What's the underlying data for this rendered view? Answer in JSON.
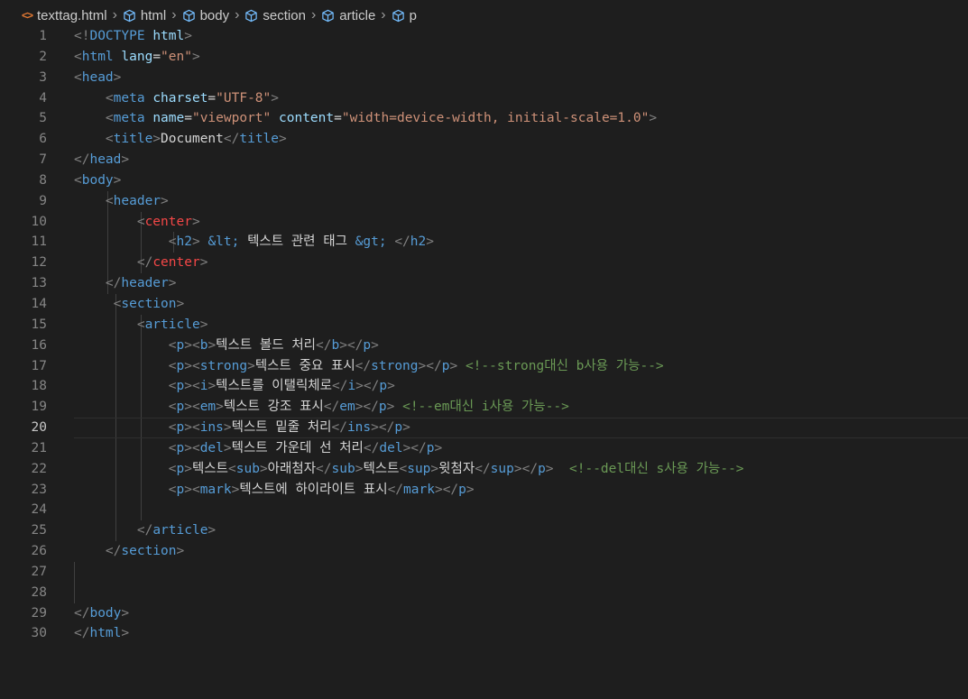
{
  "breadcrumb": {
    "file": "texttag.html",
    "items": [
      "html",
      "body",
      "section",
      "article",
      "p"
    ]
  },
  "editor": {
    "current_line": 20,
    "lines": [
      "<!DOCTYPE html>",
      "<html lang=\"en\">",
      "<head>",
      "    <meta charset=\"UTF-8\">",
      "    <meta name=\"viewport\" content=\"width=device-width, initial-scale=1.0\">",
      "    <title>Document</title>",
      "</head>",
      "<body>",
      "    <header>",
      "        <center>",
      "            <h2> &lt; 텍스트 관련 태그 &gt; </h2>",
      "        </center>",
      "    </header>",
      "     <section>",
      "        <article>",
      "            <p><b>텍스트 볼드 처리</b></p>",
      "            <p><strong>텍스트 중요 표시</strong></p> <!--strong대신 b사용 가능-->",
      "            <p><i>텍스트를 이탤릭체로</i></p>",
      "            <p><em>텍스트 강조 표시</em></p> <!--em대신 i사용 가능-->",
      "            <p><ins>텍스트 밑줄 처리</ins></p>",
      "            <p><del>텍스트 가운데 선 처리</del></p>",
      "            <p>텍스트<sub>아래첨자</sub>텍스트<sup>윗첨자</sup></p>  <!--del대신 s사용 가능-->",
      "            <p><mark>텍스트에 하이라이트 표시</mark></p>",
      "",
      "        </article>",
      "    </section>",
      "",
      "",
      "</body>",
      "</html>"
    ]
  },
  "colors": {
    "background": "#1e1e1e",
    "tag": "#569cd6",
    "deprecated_tag": "#f44747",
    "attribute": "#9cdcfe",
    "string": "#ce9178",
    "comment": "#6a9955",
    "bracket": "#808080",
    "text": "#d4d4d4"
  }
}
